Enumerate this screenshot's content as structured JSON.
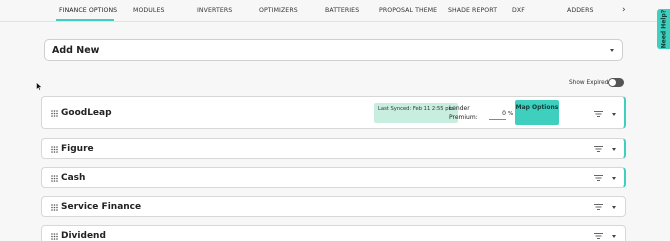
{
  "tabs": [
    {
      "label": "FINANCE OPTIONS",
      "active": true
    },
    {
      "label": "MODULES"
    },
    {
      "label": "INVERTERS"
    },
    {
      "label": "OPTIMIZERS"
    },
    {
      "label": "BATTERIES"
    },
    {
      "label": "PROPOSAL THEME"
    },
    {
      "label": "SHADE REPORT"
    },
    {
      "label": "DXF"
    },
    {
      "label": "ADDERS"
    }
  ],
  "tab_next_icon": "chevron-right-icon",
  "need_help": "Need Help?",
  "add_new": {
    "label": "Add New"
  },
  "show_expired": {
    "label": "Show Expired",
    "enabled": false
  },
  "lenders": [
    {
      "name": "GoodLeap",
      "last_synced": "Last Synced: Feb 11 2:55 pm",
      "lender_premium_label_1": "Lender",
      "lender_premium_label_2": "Premium:",
      "lender_premium_value": "0",
      "percent_symbol": "%",
      "map_options_label": "Map Options"
    },
    {
      "name": "Figure"
    },
    {
      "name": "Cash"
    },
    {
      "name": "Service Finance"
    },
    {
      "name": "Dividend"
    }
  ],
  "colors": {
    "accent": "#3ecfbf",
    "sync_badge": "#c8eee0",
    "toggle_off": "#555555"
  }
}
